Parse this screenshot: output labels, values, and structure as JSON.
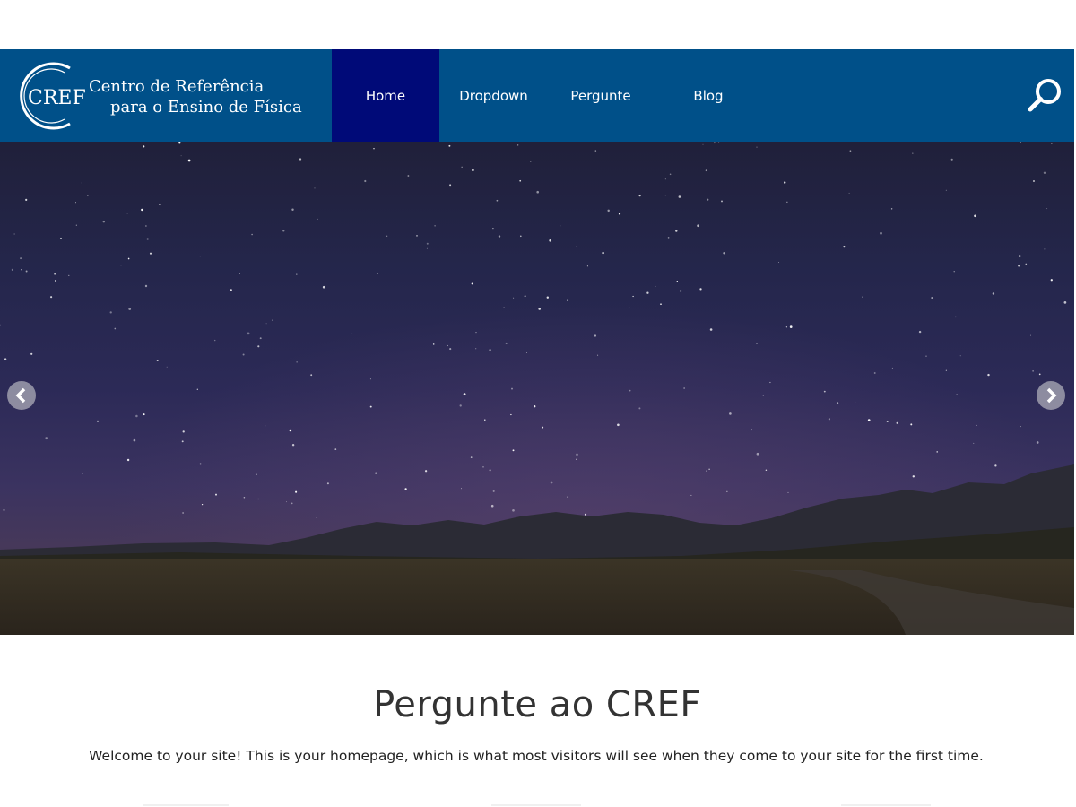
{
  "header": {
    "logo": {
      "monogram": "CREF",
      "line1": "Centro de Referência",
      "line2": "para o Ensino de Física"
    },
    "nav": [
      {
        "label": "Home",
        "active": true
      },
      {
        "label": "Dropdown",
        "active": false
      },
      {
        "label": "Pergunte",
        "active": false
      },
      {
        "label": "Blog",
        "active": false
      }
    ],
    "search_icon": "search-icon"
  },
  "hero": {
    "image": "night sky with stars over mountains and grassland",
    "prev_icon": "chevron-left-icon",
    "next_icon": "chevron-right-icon"
  },
  "main": {
    "title": "Pergunte ao CREF",
    "intro": "Welcome to your site! This is your homepage, which is what most visitors will see when they come to your site for the first time."
  },
  "colors": {
    "navbar": "#005089",
    "nav_active": "#000a78",
    "text_dark": "#333333"
  }
}
